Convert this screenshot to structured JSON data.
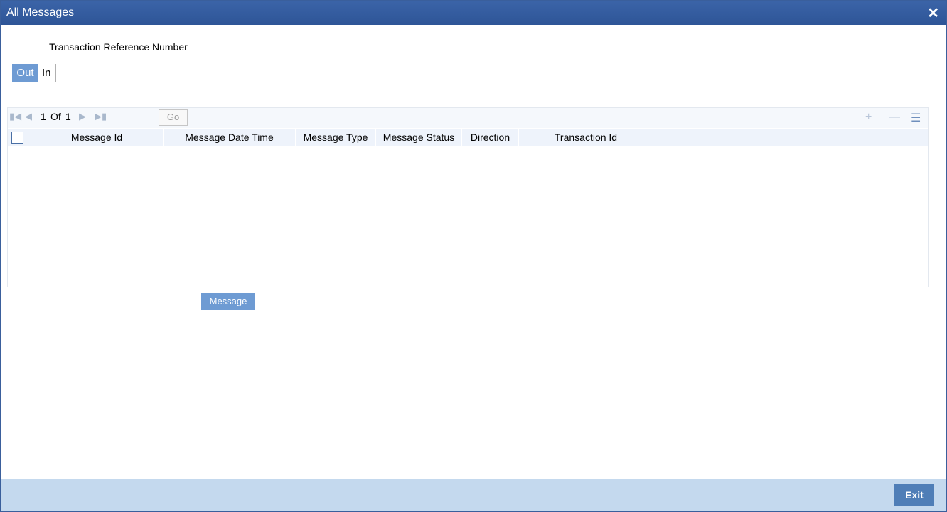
{
  "window": {
    "title": "All Messages",
    "close_glyph": "✕"
  },
  "form": {
    "trn_label": "Transaction Reference Number",
    "trn_value": ""
  },
  "tabs": [
    {
      "label": "Out",
      "active": true
    },
    {
      "label": "In",
      "active": false
    }
  ],
  "pager": {
    "current": "1",
    "of_label": "Of",
    "total": "1",
    "go_label": "Go",
    "page_input": ""
  },
  "table": {
    "columns": [
      "Message Id",
      "Message Date Time",
      "Message Type",
      "Message Status",
      "Direction",
      "Transaction Id"
    ],
    "rows": []
  },
  "buttons": {
    "message": "Message",
    "exit": "Exit"
  },
  "icons": {
    "first": "first-page-icon",
    "prev": "prev-page-icon",
    "next": "next-page-icon",
    "last": "last-page-icon",
    "add": "add-row-icon",
    "remove": "remove-row-icon",
    "columns": "columns-menu-icon"
  },
  "colors": {
    "titlebar": "#2e5597",
    "accent": "#6e9bd3",
    "footer": "#c4d9ee",
    "exit": "#4f7eb7"
  }
}
